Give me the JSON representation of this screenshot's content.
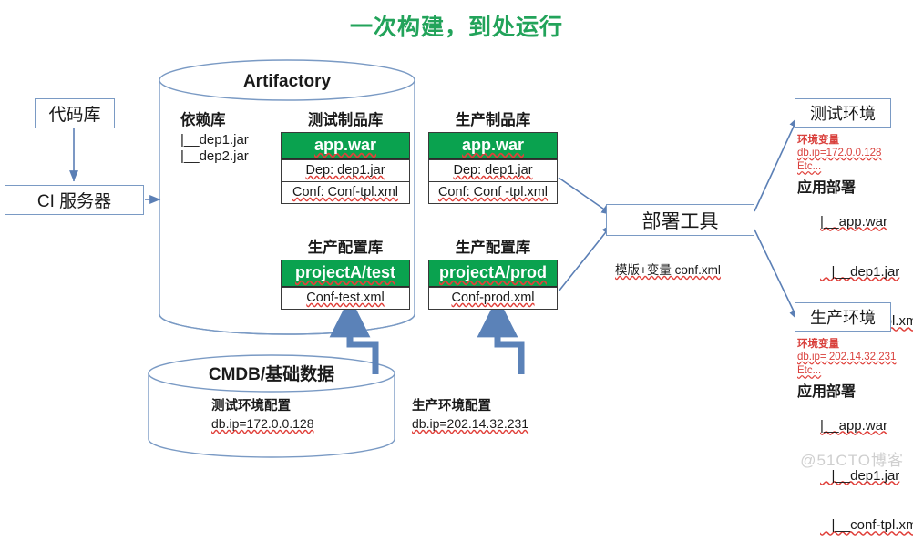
{
  "title": "一次构建，到处运行",
  "colors": {
    "title_green": "#22a35a",
    "card_header_green": "#0aa24f",
    "connector_blue": "#5b7fb5",
    "thick_arrow_blue": "#5b82b8",
    "box_border_blue": "#7a9ac4",
    "red_text": "#d9403c",
    "watermark_gray": "#cfcfcf"
  },
  "left_flow": {
    "code_repo": "代码库",
    "ci_server": "CI 服务器"
  },
  "artifactory": {
    "title": "Artifactory",
    "dependency": {
      "label": "依赖库",
      "items": [
        "|__dep1.jar",
        "|__dep2.jar"
      ]
    },
    "repos": [
      {
        "label": "测试制品库",
        "header": "app.war",
        "rows": [
          "Dep: dep1.jar",
          "Conf: Conf-tpl.xml"
        ]
      },
      {
        "label": "生产制品库",
        "header": "app.war",
        "rows": [
          "Dep: dep1.jar",
          "Conf: Conf -tpl.xml"
        ]
      }
    ],
    "configs": [
      {
        "label": "生产配置库",
        "header": "projectA/test",
        "rows": [
          "Conf-test.xml"
        ]
      },
      {
        "label": "生产配置库",
        "header": "projectA/prod",
        "rows": [
          "Conf-prod.xml"
        ]
      }
    ]
  },
  "deploy": {
    "title": "部署工具",
    "caption": "模版+变量 conf.xml"
  },
  "environments": [
    {
      "name": "测试环境",
      "env_var_label": "环境变量",
      "db_ip": "db.ip=172.0.0.128",
      "etc": "Etc...",
      "deploy_label": "应用部署",
      "tree": [
        "|__app.war",
        "   |__dep1.jar",
        "   |__conf-tpl.xml"
      ]
    },
    {
      "name": "生产环境",
      "env_var_label": "环境变量",
      "db_ip": "db.ip= 202.14.32.231",
      "etc": "Etc...",
      "deploy_label": "应用部署",
      "tree": [
        "|__app.war",
        "   |__dep1.jar",
        "   |__conf-tpl.xml"
      ]
    }
  ],
  "cmdb": {
    "title": "CMDB/基础数据",
    "entries": [
      {
        "label": "测试环境配置",
        "value": "db.ip=172.0.0.128"
      },
      {
        "label": "生产环境配置",
        "value": "db.ip=202.14.32.231"
      }
    ]
  },
  "watermark": "@51CTO博客"
}
